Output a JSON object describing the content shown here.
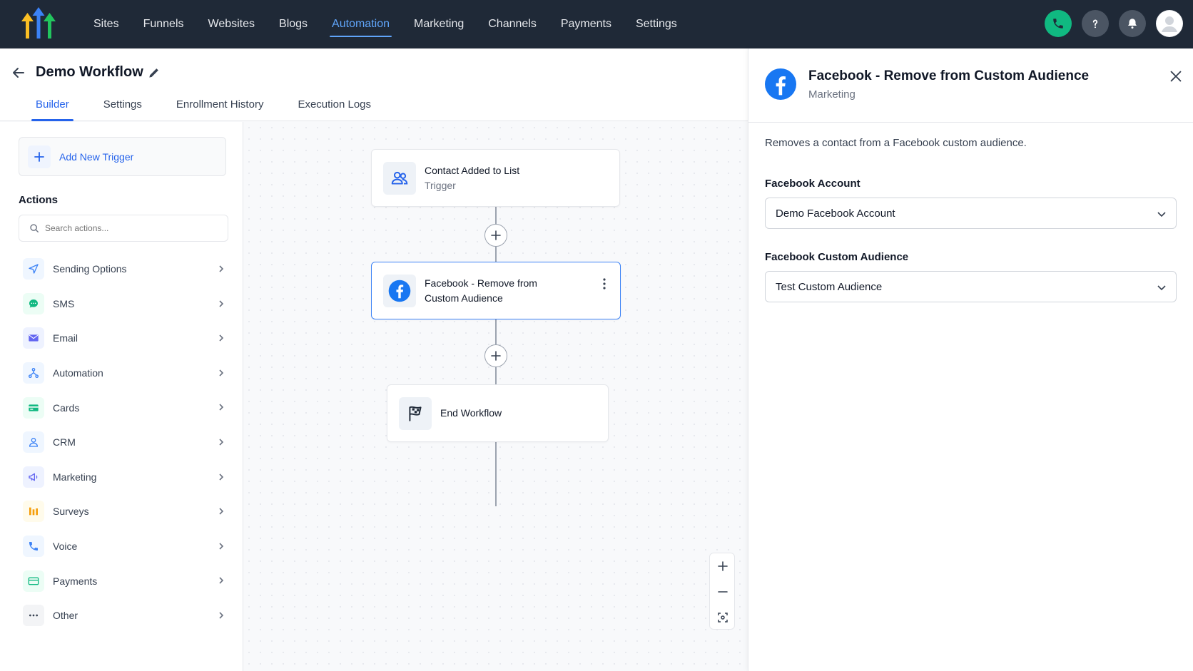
{
  "nav": {
    "items": [
      {
        "label": "Sites"
      },
      {
        "label": "Funnels"
      },
      {
        "label": "Websites"
      },
      {
        "label": "Blogs"
      },
      {
        "label": "Automation",
        "active": true
      },
      {
        "label": "Marketing"
      },
      {
        "label": "Channels"
      },
      {
        "label": "Payments"
      },
      {
        "label": "Settings"
      }
    ],
    "icons": [
      "phone-icon",
      "help-icon",
      "bell-icon",
      "avatar-icon"
    ]
  },
  "header": {
    "title": "Demo Workflow",
    "tabs": [
      "Builder",
      "Settings",
      "Enrollment History",
      "Execution Logs"
    ],
    "active_tab": "Builder"
  },
  "sidebar": {
    "add_trigger": "Add New Trigger",
    "actions_title": "Actions",
    "search_placeholder": "Search actions...",
    "items": [
      {
        "label": "Sending Options",
        "icon": "paper-plane-icon",
        "color": "#3b82f6",
        "bg": "#eff6ff"
      },
      {
        "label": "SMS",
        "icon": "chat-bubble-icon",
        "color": "#10b981",
        "bg": "#ecfdf5"
      },
      {
        "label": "Email",
        "icon": "envelope-icon",
        "color": "#6366f1",
        "bg": "#eef2ff"
      },
      {
        "label": "Automation",
        "icon": "workflow-icon",
        "color": "#3b82f6",
        "bg": "#eff6ff"
      },
      {
        "label": "Cards",
        "icon": "card-icon",
        "color": "#10b981",
        "bg": "#ecfdf5"
      },
      {
        "label": "CRM",
        "icon": "person-icon",
        "color": "#3b82f6",
        "bg": "#eff6ff"
      },
      {
        "label": "Marketing",
        "icon": "megaphone-icon",
        "color": "#6366f1",
        "bg": "#eef2ff"
      },
      {
        "label": "Surveys",
        "icon": "bar-chart-icon",
        "color": "#f59e0b",
        "bg": "#fffbeb"
      },
      {
        "label": "Voice",
        "icon": "phone-icon",
        "color": "#3b82f6",
        "bg": "#eff6ff"
      },
      {
        "label": "Payments",
        "icon": "wallet-icon",
        "color": "#10b981",
        "bg": "#ecfdf5"
      },
      {
        "label": "Other",
        "icon": "more-dots-icon",
        "color": "#6b7280",
        "bg": "#f3f4f6"
      }
    ]
  },
  "canvas": {
    "trigger": {
      "title": "Contact Added to List",
      "subtitle": "Trigger"
    },
    "action": {
      "title_line1": "Facebook - Remove from",
      "title_line2": "Custom Audience"
    },
    "end": {
      "title": "End Workflow"
    }
  },
  "panel": {
    "title": "Facebook - Remove from Custom Audience",
    "subtitle": "Marketing",
    "description": "Removes a contact from a Facebook custom audience.",
    "fields": [
      {
        "label": "Facebook Account",
        "value": "Demo Facebook Account"
      },
      {
        "label": "Facebook Custom Audience",
        "value": "Test Custom Audience"
      }
    ]
  },
  "colors": {
    "nav_bg": "#1f2937",
    "accent": "#2563eb",
    "facebook": "#1877f2"
  }
}
